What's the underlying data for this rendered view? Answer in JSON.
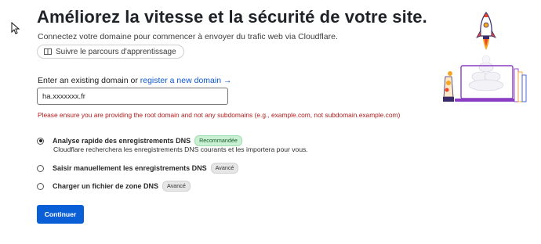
{
  "header": {
    "title": "Améliorez la vitesse et la sécurité de votre site.",
    "subtitle": "Connectez votre domaine pour commencer à envoyer du trafic web via Cloudflare.",
    "learn_button_label": "Suivre le parcours d'apprentissage"
  },
  "domain": {
    "label_prefix": "Enter an existing domain or",
    "register_link": "register a new domain →",
    "input_value": "ha.xxxxxxx.fr",
    "error_message": "Please ensure you are providing the root domain and not any subdomains (e.g., example.com, not subdomain.example.com)"
  },
  "options": [
    {
      "label": "Analyse rapide des enregistrements DNS",
      "badge": "Recommandée",
      "description": "Cloudflare recherchera les enregistrements DNS courants et les importera pour vous.",
      "selected": true
    },
    {
      "label": "Saisir manuellement les enregistrements DNS",
      "badge": "Avancé",
      "selected": false
    },
    {
      "label": "Charger un fichier de zone DNS",
      "badge": "Avancé",
      "selected": false
    }
  ],
  "actions": {
    "continue_label": "Continuer"
  },
  "colors": {
    "primary": "#0b5fd6",
    "link": "#0b57d0",
    "error": "#b01c1c",
    "badge_recommended": "#c9f0d2"
  },
  "icons": {
    "cursor": "mouse-pointer-icon",
    "learn": "book-icon",
    "illustration": "rocket-laptop-illustration"
  }
}
